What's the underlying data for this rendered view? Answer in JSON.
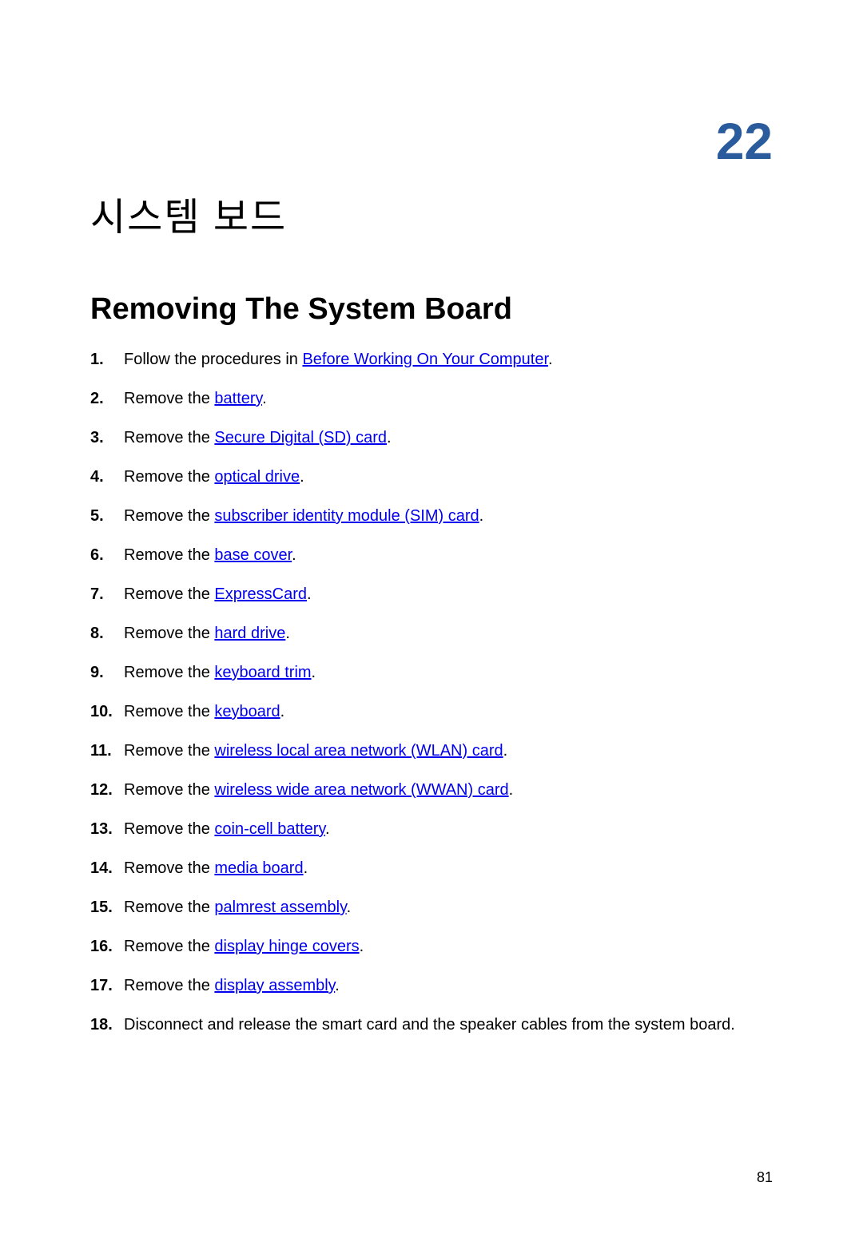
{
  "chapter": {
    "number": "22",
    "title": "시스템 보드"
  },
  "section": {
    "title": "Removing The System Board"
  },
  "steps": [
    {
      "prefix": "Follow the procedures in ",
      "link": "Before Working On Your Computer",
      "suffix": "."
    },
    {
      "prefix": "Remove the ",
      "link": "battery",
      "suffix": "."
    },
    {
      "prefix": "Remove the ",
      "link": "Secure Digital (SD) card",
      "suffix": "."
    },
    {
      "prefix": "Remove the ",
      "link": "optical drive",
      "suffix": "."
    },
    {
      "prefix": "Remove the ",
      "link": "subscriber identity module (SIM) card",
      "suffix": "."
    },
    {
      "prefix": "Remove the ",
      "link": "base cover",
      "suffix": "."
    },
    {
      "prefix": "Remove the ",
      "link": "ExpressCard",
      "suffix": "."
    },
    {
      "prefix": "Remove the ",
      "link": "hard drive",
      "suffix": "."
    },
    {
      "prefix": "Remove the ",
      "link": "keyboard trim",
      "suffix": "."
    },
    {
      "prefix": "Remove the ",
      "link": "keyboard",
      "suffix": "."
    },
    {
      "prefix": "Remove the ",
      "link": "wireless local area network (WLAN) card",
      "suffix": "."
    },
    {
      "prefix": "Remove the ",
      "link": "wireless wide area network (WWAN) card",
      "suffix": "."
    },
    {
      "prefix": "Remove the ",
      "link": "coin-cell battery",
      "suffix": "."
    },
    {
      "prefix": "Remove the ",
      "link": "media board",
      "suffix": "."
    },
    {
      "prefix": "Remove the ",
      "link": "palmrest assembly",
      "suffix": "."
    },
    {
      "prefix": "Remove the ",
      "link": "display hinge covers",
      "suffix": "."
    },
    {
      "prefix": "Remove the ",
      "link": "display assembly",
      "suffix": "."
    },
    {
      "prefix": "Disconnect and release the smart card and the speaker cables from the system board.",
      "link": "",
      "suffix": ""
    }
  ],
  "pageNumber": "81"
}
